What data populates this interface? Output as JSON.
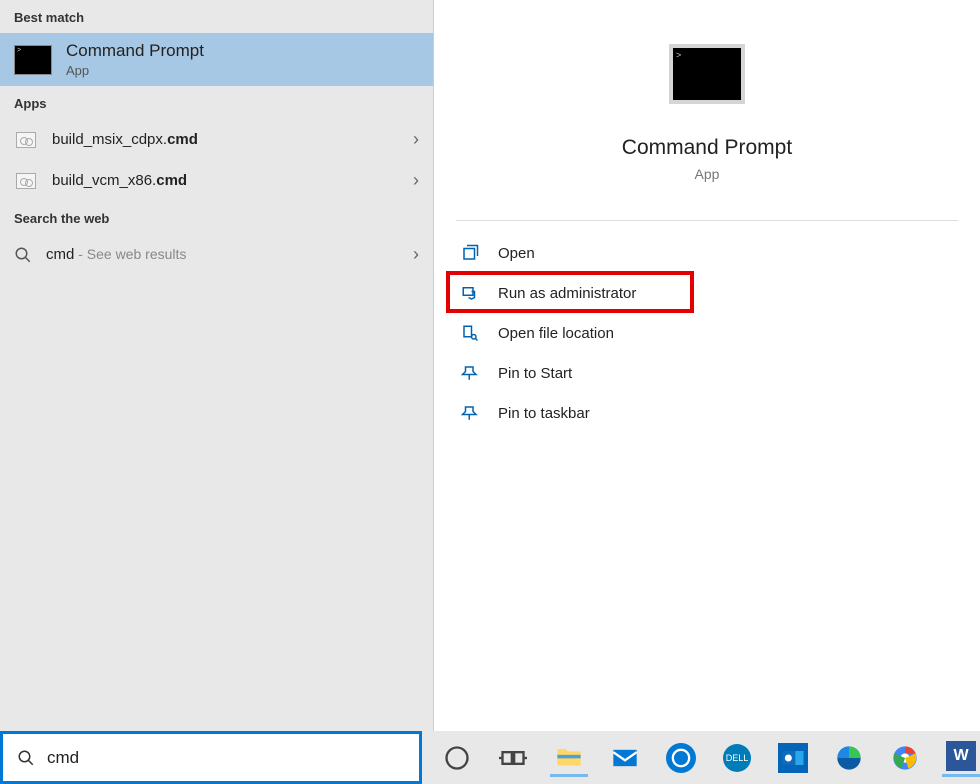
{
  "left": {
    "sections": {
      "best_match_header": "Best match",
      "apps_header": "Apps",
      "web_header": "Search the web"
    },
    "best_match": {
      "title": "Command Prompt",
      "subtitle": "App"
    },
    "apps": [
      {
        "prefix": "build_msix_cdpx.",
        "suffix": "cmd"
      },
      {
        "prefix": "build_vcm_x86.",
        "suffix": "cmd"
      }
    ],
    "web": {
      "query": "cmd",
      "hint": " - See web results"
    }
  },
  "right": {
    "title": "Command Prompt",
    "subtitle": "App",
    "actions": [
      {
        "label": "Open",
        "icon": "open"
      },
      {
        "label": "Run as administrator",
        "icon": "admin",
        "highlighted": true
      },
      {
        "label": "Open file location",
        "icon": "folder"
      },
      {
        "label": "Pin to Start",
        "icon": "pin"
      },
      {
        "label": "Pin to taskbar",
        "icon": "pin"
      }
    ]
  },
  "search": {
    "value": "cmd"
  },
  "taskbar": {
    "items": [
      "cortana",
      "task-view",
      "explorer",
      "mail",
      "blue-app",
      "dell",
      "outlook",
      "edge",
      "chrome",
      "word"
    ]
  }
}
